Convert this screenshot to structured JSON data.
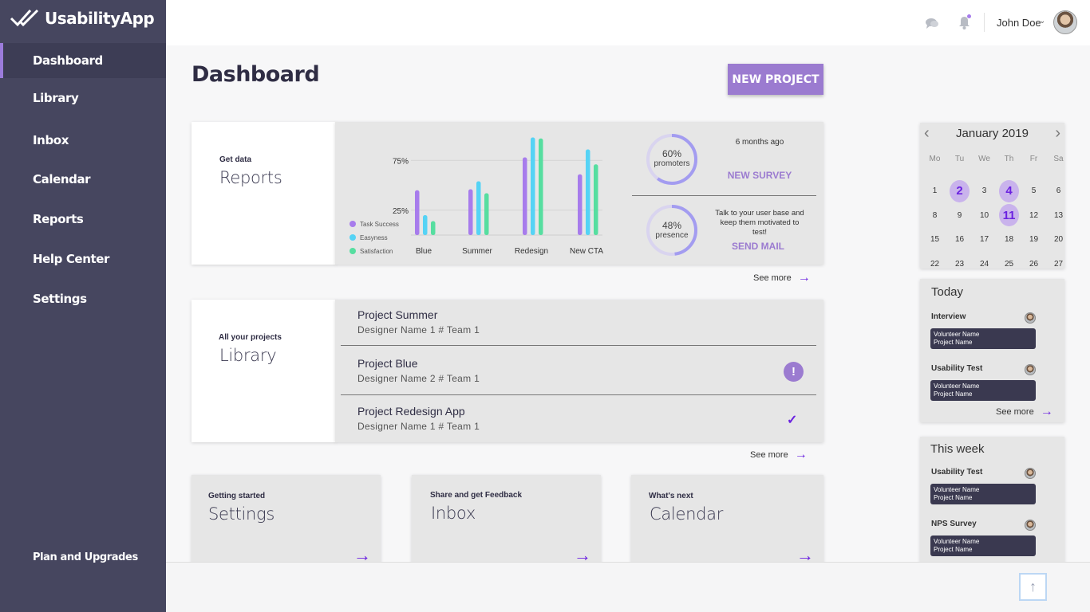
{
  "app": {
    "name": "UsabilityApp"
  },
  "sidebar": {
    "items": [
      {
        "label": "Dashboard"
      },
      {
        "label": "Library"
      },
      {
        "label": "Inbox"
      },
      {
        "label": "Calendar"
      },
      {
        "label": "Reports"
      },
      {
        "label": "Help Center"
      },
      {
        "label": "Settings"
      }
    ],
    "bottom": {
      "label": "Plan and Upgrades"
    }
  },
  "topbar": {
    "user_name": "John Doe"
  },
  "page": {
    "title": "Dashboard",
    "new_project_label": "NEW PROJECT"
  },
  "reports_card": {
    "subtitle": "Get data",
    "title": "Reports",
    "see_more": "See more"
  },
  "chart_data": {
    "type": "bar",
    "categories": [
      "Blue",
      "Summer",
      "Redesign",
      "New CTA"
    ],
    "series": [
      {
        "name": "Task Success",
        "values": [
          45,
          46,
          78,
          61
        ],
        "color": "#a77cec"
      },
      {
        "name": "Easyness",
        "values": [
          20,
          54,
          98,
          86
        ],
        "color": "#55d3f5"
      },
      {
        "name": "Satisfaction",
        "values": [
          14,
          42,
          97,
          71
        ],
        "color": "#56dea0"
      }
    ],
    "ytick_labels": [
      "75%",
      "25%"
    ],
    "ylim": [
      0,
      100
    ],
    "legend": "left"
  },
  "stats": {
    "promoters": {
      "value": "60%",
      "label": "promoters",
      "fraction": 0.6
    },
    "presence": {
      "value": "48%",
      "label": "presence",
      "fraction": 0.48
    },
    "survey_time": "6 months ago",
    "new_survey": "NEW SURVEY",
    "mail_text": "Talk to your user base and keep them motivated to test!",
    "send_mail": "SEND MAIL"
  },
  "library_card": {
    "subtitle": "All your projects",
    "title": "Library",
    "see_more": "See more",
    "projects": [
      {
        "title": "Project Summer",
        "sub": "Designer Name 1 # Team 1"
      },
      {
        "title": "Project Blue",
        "sub": "Designer Name 2 # Team 1",
        "status": "!"
      },
      {
        "title": "Project Redesign App",
        "sub": "Designer Name 1 # Team 1",
        "status": "✓"
      }
    ]
  },
  "bottom_cards": [
    {
      "subtitle": "Getting started",
      "title": "Settings"
    },
    {
      "subtitle": "Share and get Feedback",
      "title": "Inbox"
    },
    {
      "subtitle": "What's next",
      "title": "Calendar"
    }
  ],
  "calendar": {
    "title": "January 2019",
    "weekdays": [
      "Mo",
      "Tu",
      "We",
      "Th",
      "Fr",
      "Sa"
    ],
    "days": [
      [
        "1",
        "2",
        "3",
        "4",
        "5",
        "6"
      ],
      [
        "8",
        "9",
        "10",
        "11",
        "12",
        "13"
      ],
      [
        "15",
        "16",
        "17",
        "18",
        "19",
        "20"
      ],
      [
        "22",
        "23",
        "24",
        "25",
        "26",
        "27"
      ]
    ],
    "highlighted": [
      "2",
      "4",
      "11"
    ]
  },
  "today": {
    "title": "Today",
    "see_more": "See more",
    "events": [
      {
        "title": "Interview",
        "line1": "Volunteer Name",
        "line2": "Project Name"
      },
      {
        "title": "Usability Test",
        "line1": "Volunteer Name",
        "line2": "Project Name"
      }
    ]
  },
  "week": {
    "title": "This week",
    "events": [
      {
        "title": "Usability Test",
        "line1": "Volunteer Name",
        "line2": "Project Name"
      },
      {
        "title": "NPS Survey",
        "line1": "Volunteer Name",
        "line2": "Project Name"
      }
    ]
  }
}
